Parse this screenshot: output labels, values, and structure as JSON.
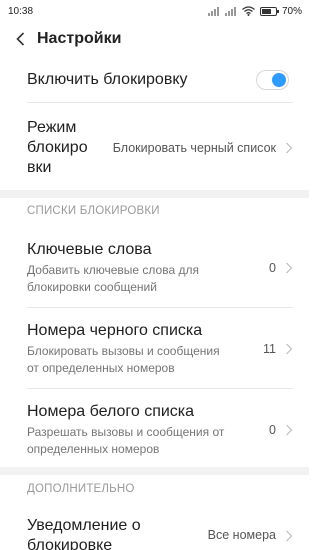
{
  "status_bar": {
    "time": "10:38",
    "battery": "70%",
    "battery_level": 0.7
  },
  "header": {
    "title": "Настройки"
  },
  "enable_block": {
    "label": "Включить блокировку",
    "enabled": true,
    "accent": "#2e9cff"
  },
  "block_mode": {
    "label_line1": "Режим",
    "label_line2": "блокиро",
    "label_line3": "вки",
    "value": "Блокировать черный список"
  },
  "section_lists": {
    "title": "СПИСКИ БЛОКИРОВКИ"
  },
  "keywords": {
    "label": "Ключевые слова",
    "sub_line1": "Добавить ключевые слова для",
    "sub_line2": "блокировки сообщений",
    "count": "0"
  },
  "blacklist": {
    "label": "Номера черного списка",
    "sub_line1": "Блокировать вызовы и сообщения",
    "sub_line2": "от определенных номеров",
    "count": "11"
  },
  "whitelist": {
    "label": "Номера белого списка",
    "sub_line1": "Разрешать вызовы и сообщения от",
    "sub_line2": "определенных номеров",
    "count": "0"
  },
  "section_extra": {
    "title": "ДОПОЛНИТЕЛЬНО"
  },
  "notification": {
    "label_line1": "Уведомление о",
    "label_line2": "блокировке",
    "value": "Все номера"
  },
  "icons": {
    "back": "chevron-left-icon",
    "chevron": "chevron-right-icon",
    "wifi": "wifi-icon",
    "battery": "battery-icon",
    "signal": "signal-icon"
  }
}
